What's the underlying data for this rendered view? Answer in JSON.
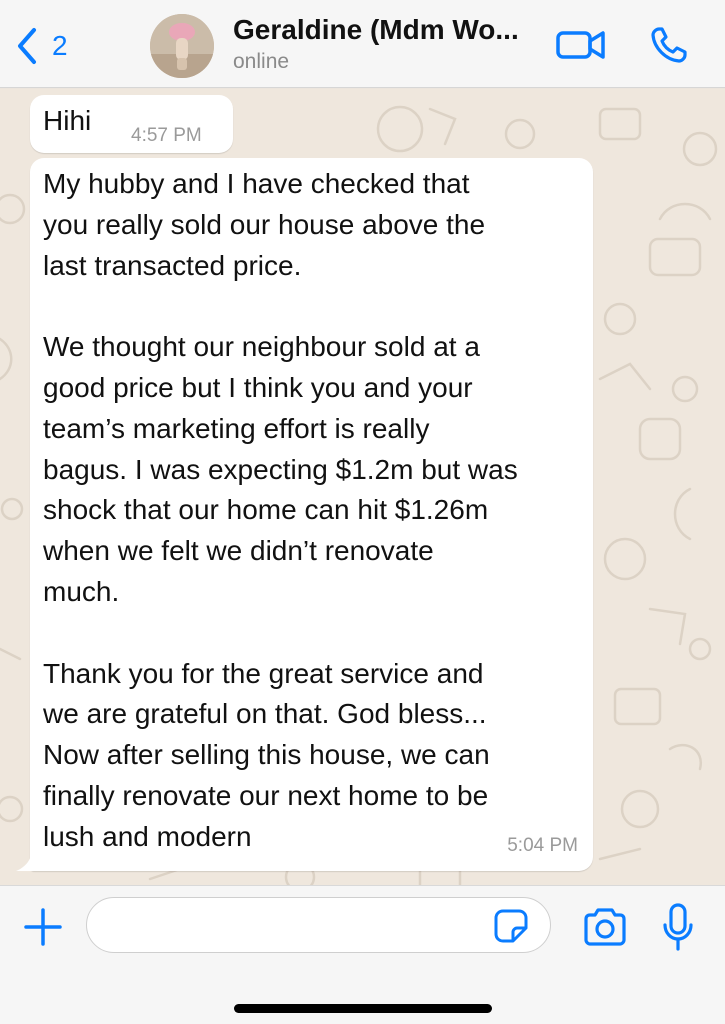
{
  "header": {
    "back_count": "2",
    "contact_name": "Geraldine (Mdm Wo...",
    "status": "online"
  },
  "messages": [
    {
      "text": "Hihi",
      "time": "4:57 PM"
    },
    {
      "text": "My hubby and I have checked that\nyou really sold our house above the\nlast transacted price.\n\nWe thought our neighbour sold at a\ngood price but I think you and your\nteam’s marketing effort is really\nbagus. I was expecting $1.2m but was\nshock that our home can hit $1.26m\nwhen we felt we didn’t renovate\nmuch.\n\nThank you for the great service and\nwe are grateful on that. God bless...\nNow after selling this house, we can\nfinally renovate our next home to be\nlush and modern",
      "time": "5:04 PM"
    }
  ],
  "input": {
    "placeholder": ""
  },
  "icons": {
    "back": "chevron-left-icon",
    "video": "video-call-icon",
    "phone": "phone-icon",
    "plus": "plus-icon",
    "sticker": "sticker-icon",
    "camera": "camera-icon",
    "mic": "microphone-icon"
  },
  "colors": {
    "accent": "#0a7cff",
    "chat_background": "#efe7dd",
    "bubble": "#ffffff",
    "header": "#f6f6f6"
  }
}
